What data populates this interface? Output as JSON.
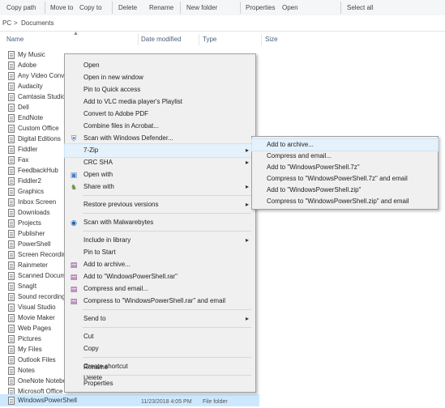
{
  "ribbon": {
    "groups": [
      {
        "label": "Copy path"
      },
      {
        "label": "Move to"
      },
      {
        "label": "Copy to"
      },
      {
        "label": "Delete"
      },
      {
        "label": "Rename"
      },
      {
        "label": "New folder"
      },
      {
        "label": "Properties"
      },
      {
        "label": "Open"
      },
      {
        "label": "Select all"
      }
    ]
  },
  "address": {
    "root": "PC",
    "separator": ">",
    "folder": "Documents"
  },
  "columns": {
    "name": "Name",
    "date": "Date modified",
    "type": "Type",
    "size": "Size"
  },
  "files": [
    {
      "name": "My Music"
    },
    {
      "name": "Adobe"
    },
    {
      "name": "Any Video Converter"
    },
    {
      "name": "Audacity"
    },
    {
      "name": "Camtasia Studio"
    },
    {
      "name": "Dell"
    },
    {
      "name": "EndNote"
    },
    {
      "name": "Custom Office"
    },
    {
      "name": "Digital Editions"
    },
    {
      "name": "Fiddler"
    },
    {
      "name": "Fax"
    },
    {
      "name": "FeedbackHub"
    },
    {
      "name": "Fiddler2"
    },
    {
      "name": "Graphics"
    },
    {
      "name": "Inbox Screen"
    },
    {
      "name": "Downloads"
    },
    {
      "name": "Projects"
    },
    {
      "name": "Publisher"
    },
    {
      "name": "PowerShell"
    },
    {
      "name": "Screen Recordings"
    },
    {
      "name": "Rainmeter"
    },
    {
      "name": "Scanned Documents"
    },
    {
      "name": "SnagIt"
    },
    {
      "name": "Sound recordings"
    },
    {
      "name": "Visual Studio"
    },
    {
      "name": "Movie Maker"
    },
    {
      "name": "Web Pages"
    },
    {
      "name": "Pictures"
    },
    {
      "name": "My Files"
    },
    {
      "name": "Outlook Files"
    },
    {
      "name": "Notes"
    },
    {
      "name": "OneNote Notebooks"
    },
    {
      "name": "Microsoft Office"
    },
    {
      "name": "WindowsPowerShell"
    }
  ],
  "selected_file": {
    "name": "WindowsPowerShell",
    "date": "11/23/2018 4:05 PM",
    "type": "File folder"
  },
  "context_menu": {
    "items": [
      {
        "label": "Open"
      },
      {
        "label": "Open in new window"
      },
      {
        "label": "Pin to Quick access"
      },
      {
        "label": "Add to VLC media player's Playlist"
      },
      {
        "label": "Convert to Adobe PDF"
      },
      {
        "label": "Combine files in Acrobat..."
      },
      {
        "label": "Scan with Windows Defender..."
      },
      {
        "label": "7-Zip"
      },
      {
        "label": "CRC SHA"
      },
      {
        "label": "Open with"
      },
      {
        "label": "Share with"
      },
      {
        "label": "Restore previous versions"
      },
      {
        "label": "Scan with Malwarebytes"
      },
      {
        "label": "Include in library"
      },
      {
        "label": "Pin to Start"
      },
      {
        "label": "Add to archive..."
      },
      {
        "label": "Add to \"WindowsPowerShell.rar\""
      },
      {
        "label": "Compress and email..."
      },
      {
        "label": "Compress to \"WindowsPowerShell.rar\" and email"
      },
      {
        "label": "Send to"
      },
      {
        "label": "Cut"
      },
      {
        "label": "Copy"
      },
      {
        "label": "Create shortcut"
      },
      {
        "label": "Delete"
      },
      {
        "label": "Rename"
      },
      {
        "label": "Properties"
      }
    ]
  },
  "submenu": {
    "items": [
      {
        "label": "Add to archive..."
      },
      {
        "label": "Compress and email..."
      },
      {
        "label": "Add to \"WindowsPowerShell.7z\""
      },
      {
        "label": "Compress to \"WindowsPowerShell.7z\" and email"
      },
      {
        "label": "Add to \"WindowsPowerShell.zip\""
      },
      {
        "label": "Compress to \"WindowsPowerShell.zip\" and email"
      }
    ]
  },
  "icons": {
    "defender": "shield-icon",
    "winrar": "winrar-icon",
    "malwarebytes": "malwarebytes-icon",
    "chevron": "chevron-right-icon"
  },
  "colors": {
    "selection": "#cce8ff",
    "menu_bg": "#f0f0f0",
    "hover": "#e5f1fb"
  }
}
